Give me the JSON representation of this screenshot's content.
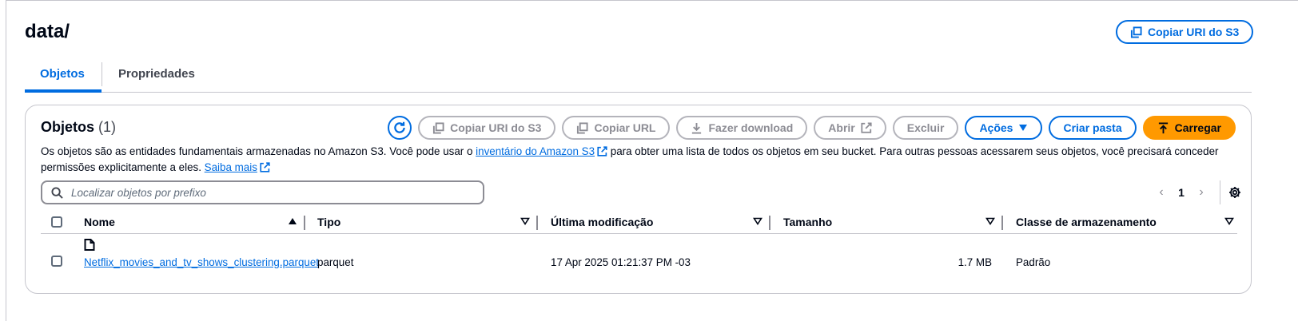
{
  "header": {
    "title": "data/",
    "copy_uri_label": "Copiar URI do S3"
  },
  "tabs": [
    {
      "label": "Objetos",
      "active": true
    },
    {
      "label": "Propriedades",
      "active": false
    }
  ],
  "panel": {
    "title": "Objetos",
    "count": "(1)",
    "toolbar": {
      "refresh_icon": "refresh-icon",
      "copy_s3_uri": "Copiar URI do S3",
      "copy_url": "Copiar URL",
      "download": "Fazer download",
      "open": "Abrir",
      "delete": "Excluir",
      "actions": "Ações",
      "create_folder": "Criar pasta",
      "upload": "Carregar"
    },
    "description": {
      "before_link": "Os objetos são as entidades fundamentais armazenadas no Amazon S3. Você pode usar o ",
      "inventory_link": "inventário do Amazon S3",
      "after_link": " para obter uma lista de todos os objetos em seu bucket. Para outras pessoas acessarem seus objetos, você precisará conceder permissões explicitamente a eles. ",
      "learn_more": "Saiba mais"
    },
    "search": {
      "placeholder": "Localizar objetos por prefixo",
      "value": ""
    },
    "pagination": {
      "current_page": "1"
    },
    "table": {
      "columns": [
        "Nome",
        "Tipo",
        "Última modificação",
        "Tamanho",
        "Classe de armazenamento"
      ],
      "rows": [
        {
          "name": "Netflix_movies_and_tv_shows_clustering.parquet",
          "type": "parquet",
          "last_modified": "17 Apr 2025 01:21:37 PM -03",
          "size": "1.7 MB",
          "storage_class": "Padrão"
        }
      ]
    }
  },
  "colors": {
    "accent": "#006ce0",
    "primary_button": "#ff9900",
    "disabled": "#8c8c94",
    "border": "#c6c6cd"
  }
}
